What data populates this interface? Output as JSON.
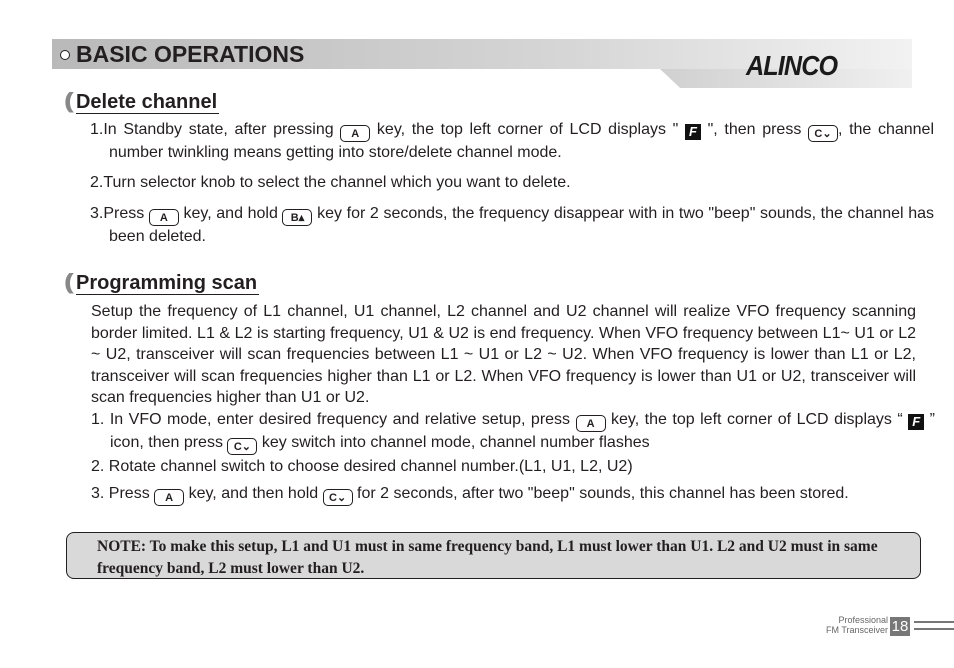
{
  "header": {
    "title": "BASIC OPERATIONS",
    "logo": "ALINCO"
  },
  "keys": {
    "a": "A",
    "b": "B",
    "c": "C",
    "f": "F"
  },
  "delete": {
    "title": "Delete channel",
    "s1a": "1.In Standby state, after pressing ",
    "s1b": " key, the top left corner of LCD displays \" ",
    "s1c": " \", then press ",
    "s1d": ", the channel number twinkling means getting into store/delete channel mode.",
    "s2": "2.Turn selector knob to select the channel which you want to delete.",
    "s3a": "3.Press ",
    "s3b": " key, and hold ",
    "s3c": " key for 2 seconds, the frequency disappear with in two \"beep\" sounds, the channel has been deleted."
  },
  "scan": {
    "title": "Programming scan",
    "intro": "Setup the frequency of L1 channel, U1 channel, L2 channel and U2 channel will realize VFO frequency scanning border limited. L1 & L2 is starting frequency, U1 & U2 is end frequency. When VFO frequency between L1~ U1 or L2 ~ U2, transceiver will scan frequencies between L1 ~ U1 or L2 ~ U2. When VFO frequency is lower than L1 or L2, transceiver will scan frequencies higher than L1 or L2. When VFO frequency is lower than U1 or U2, transceiver will scan frequencies higher than U1 or U2.",
    "s1a": "1. In VFO mode, enter desired frequency and relative setup, press ",
    "s1b": " key, the top left corner of LCD displays “ ",
    "s1c": " ” icon, then press ",
    "s1d": " key switch into channel mode, channel number flashes",
    "s2": "2. Rotate channel switch to choose desired channel number.(L1, U1, L2, U2)",
    "s3a": "3. Press ",
    "s3b": " key, and then hold ",
    "s3c": " for 2 seconds, after two \"beep\" sounds, this channel has been stored."
  },
  "note": "NOTE: To make this setup, L1 and U1 must in same frequency band, L1 must lower than U1. L2 and U2 must in same frequency band, L2 must lower than U2.",
  "footer": {
    "line1": "Professional",
    "line2": "FM Transceiver",
    "page": "18"
  }
}
